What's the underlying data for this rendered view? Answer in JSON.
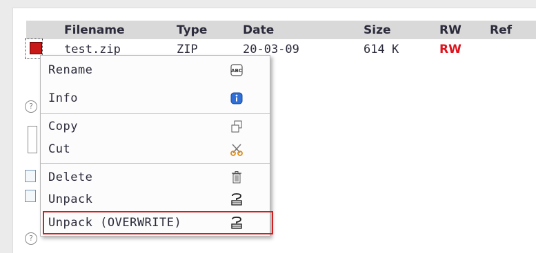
{
  "table": {
    "headers": [
      "Filename",
      "Type",
      "Date",
      "Size",
      "RW",
      "Ref"
    ],
    "row": {
      "filename": "test.zip",
      "type": "ZIP",
      "date": "20-03-09",
      "size": "614 K",
      "rw": "RW"
    }
  },
  "context_menu": {
    "items": [
      {
        "label": "Rename",
        "icon": "rename-abc-icon"
      },
      {
        "label": "Info",
        "icon": "info-icon"
      },
      {
        "label": "Copy",
        "icon": "copy-icon"
      },
      {
        "label": "Cut",
        "icon": "scissors-icon"
      },
      {
        "label": "Delete",
        "icon": "trash-icon"
      },
      {
        "label": "Unpack",
        "icon": "unpack-icon"
      },
      {
        "label": "Unpack (OVERWRITE)",
        "icon": "unpack-overwrite-icon"
      }
    ],
    "highlighted_item": "Unpack (OVERWRITE)"
  },
  "colors": {
    "rw_red": "#e0141e",
    "highlight_red": "#d21e1e",
    "header_bg": "#d9d9d9",
    "info_blue": "#2f6fd6",
    "scissors_orange": "#e08a10"
  }
}
